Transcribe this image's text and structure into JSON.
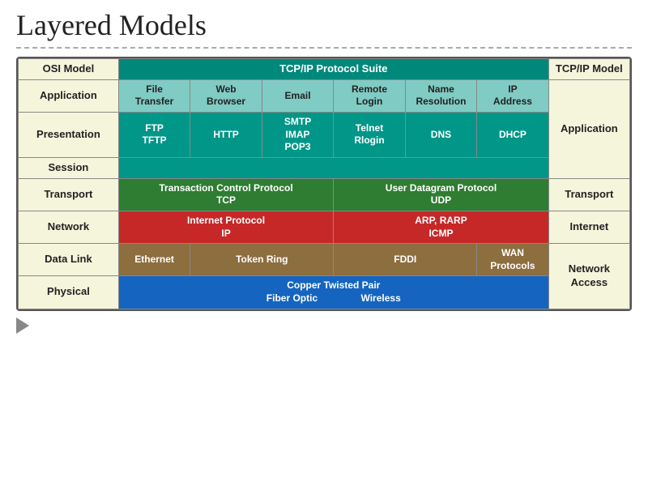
{
  "title": "Layered Models",
  "table": {
    "headers": {
      "osi": "OSI Model",
      "tcpip_suite": "TCP/IP Protocol Suite",
      "tcpip_model": "TCP/IP Model"
    },
    "rows": {
      "application": {
        "osi_label": "Application",
        "cols": [
          {
            "lines": [
              "File",
              "Transfer"
            ]
          },
          {
            "lines": [
              "Web",
              "Browser"
            ]
          },
          {
            "lines": [
              "Email"
            ]
          },
          {
            "lines": [
              "Remote",
              "Login"
            ]
          },
          {
            "lines": [
              "Name",
              "Resolution"
            ]
          },
          {
            "lines": [
              "IP",
              "Address"
            ]
          }
        ]
      },
      "presentation": {
        "osi_label": "Presentation",
        "cols": [
          {
            "lines": [
              "FTP",
              "TFTP"
            ]
          },
          {
            "lines": [
              "HTTP"
            ]
          },
          {
            "lines": [
              "SMTP",
              "IMAP",
              "POP3"
            ]
          },
          {
            "lines": [
              "Telnet",
              "Rlogin"
            ]
          },
          {
            "lines": [
              "DNS"
            ]
          },
          {
            "lines": [
              "DHCP"
            ]
          }
        ]
      },
      "session": {
        "osi_label": "Session"
      },
      "transport": {
        "osi_label": "Transport",
        "tcp": "Transaction Control Protocol\nTCP",
        "udp": "User Datagram Protocol\nUDP",
        "model_label": "Transport"
      },
      "network": {
        "osi_label": "Network",
        "ip": "Internet Protocol\nIP",
        "arp": "ARP, RARP\nICMP",
        "model_label": "Internet"
      },
      "datalink": {
        "osi_label": "Data Link",
        "ethernet": "Ethernet",
        "token_ring": "Token Ring",
        "fddi": "FDDI",
        "wan": "WAN\nProtocols",
        "model_label": "Network\nAccess"
      },
      "physical": {
        "osi_label": "Physical",
        "copper": "Copper Twisted Pair",
        "fiber": "Fiber Optic",
        "wireless": "Wireless"
      }
    },
    "right_labels": {
      "application": "Application",
      "transport": "Transport",
      "internet": "Internet",
      "network_access": "Network\nAccess"
    }
  }
}
